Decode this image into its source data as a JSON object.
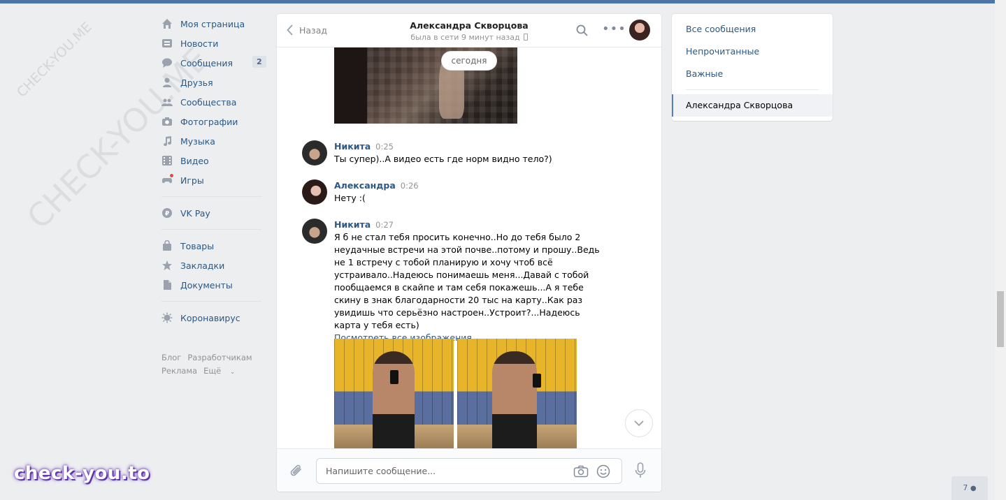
{
  "watermark": {
    "small": "CHECK-YOU.ME",
    "big": "CHECK-YOU.ME",
    "brand": "check-you.to"
  },
  "nav": {
    "items": [
      {
        "label": "Моя страница",
        "icon": "home-icon"
      },
      {
        "label": "Новости",
        "icon": "news-icon"
      },
      {
        "label": "Сообщения",
        "icon": "messages-icon",
        "count": "2"
      },
      {
        "label": "Друзья",
        "icon": "friends-icon"
      },
      {
        "label": "Сообщества",
        "icon": "groups-icon"
      },
      {
        "label": "Фотографии",
        "icon": "camera-icon"
      },
      {
        "label": "Музыка",
        "icon": "music-icon"
      },
      {
        "label": "Видео",
        "icon": "video-icon"
      },
      {
        "label": "Игры",
        "icon": "games-icon"
      }
    ],
    "vkpay": "VK Pay",
    "items2": [
      {
        "label": "Товары",
        "icon": "bag-icon"
      },
      {
        "label": "Закладки",
        "icon": "star-icon"
      },
      {
        "label": "Документы",
        "icon": "document-icon"
      }
    ],
    "corona": "Коронавирус",
    "footer": {
      "blog": "Блог",
      "dev": "Разработчикам",
      "ads": "Реклама",
      "more": "Ещё"
    }
  },
  "chat": {
    "back": "Назад",
    "peer_name": "Александра Скворцова",
    "peer_status": "была в сети 9 минут назад",
    "day_label": "сегодня",
    "messages": [
      {
        "author": "Никита",
        "time": "0:25",
        "text": "Ты супер)..А видео есть где норм видно тело?)"
      },
      {
        "author": "Александра",
        "time": "0:26",
        "text": "Нету :("
      },
      {
        "author": "Никита",
        "time": "0:27",
        "text": "Я б не стал тебя просить конечно..Но до тебя было 2 неудачные встречи на этой почве..потому и прошу..Ведь не 1 встречу с тобой планирую и хочу чтоб всё устраивало..Надеюсь понимаешь меня...Давай с тобой пообщаемся в скайпе и там себя покажешь...А я тебе скину в знак благодарности 20 тыс на карту..Как раз увидишь что серьёзно настроен..Устроит?...Надеюсь карта у тебя есть)",
        "link": "Посмотреть все изображения"
      }
    ],
    "composer_placeholder": "Напишите сообщение..."
  },
  "right_menu": {
    "all": "Все сообщения",
    "unread": "Непрочитанные",
    "important": "Важные",
    "active": "Александра Скворцова"
  },
  "friends_online": "7"
}
